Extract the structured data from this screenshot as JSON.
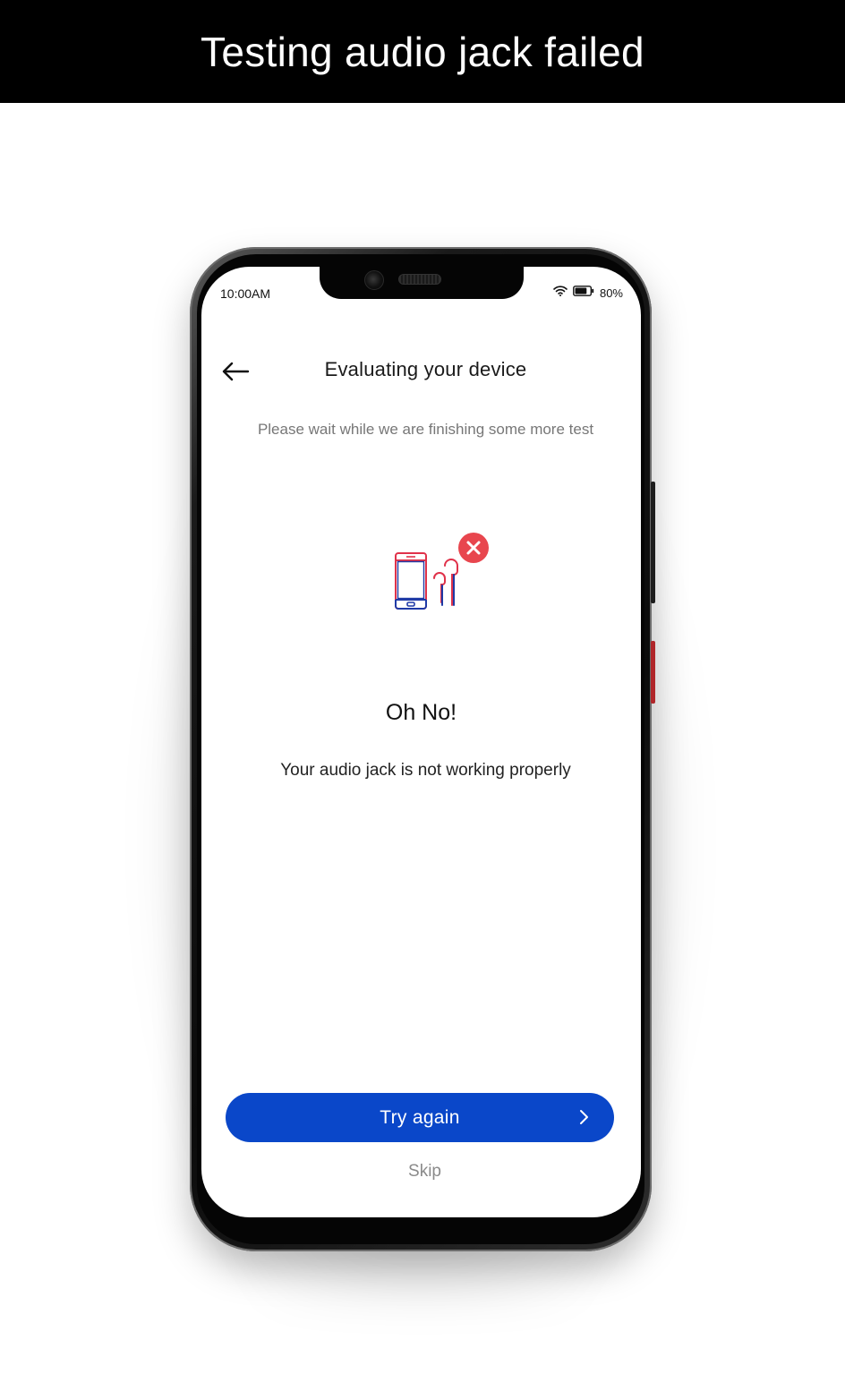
{
  "banner": {
    "title": "Testing audio jack failed"
  },
  "status_bar": {
    "time": "10:00AM",
    "battery_percent": "80%",
    "battery_level": 0.8
  },
  "header": {
    "title": "Evaluating your device"
  },
  "subtitle": "Please wait while we are finishing some more test",
  "result": {
    "heading": "Oh No!",
    "message": "Your audio jack is not working properly"
  },
  "actions": {
    "primary_label": "Try again",
    "secondary_label": "Skip"
  },
  "colors": {
    "primary_button": "#0a47c9",
    "error_badge": "#e8464e",
    "illustration_red": "#e0324a",
    "illustration_blue": "#1f3aa6"
  },
  "icons": {
    "back": "arrow-left-icon",
    "wifi": "wifi-icon",
    "battery": "battery-icon",
    "illustration": "phone-earphones-icon",
    "error": "close-circle-icon",
    "chevron": "chevron-right-icon"
  }
}
